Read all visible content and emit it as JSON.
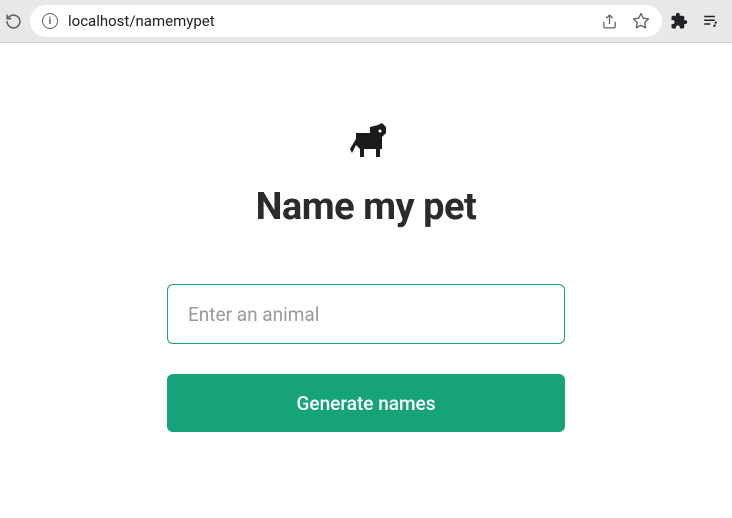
{
  "browser": {
    "url": "localhost/namemypet"
  },
  "page": {
    "title": "Name my pet",
    "input": {
      "placeholder": "Enter an animal",
      "value": ""
    },
    "button_label": "Generate names"
  }
}
